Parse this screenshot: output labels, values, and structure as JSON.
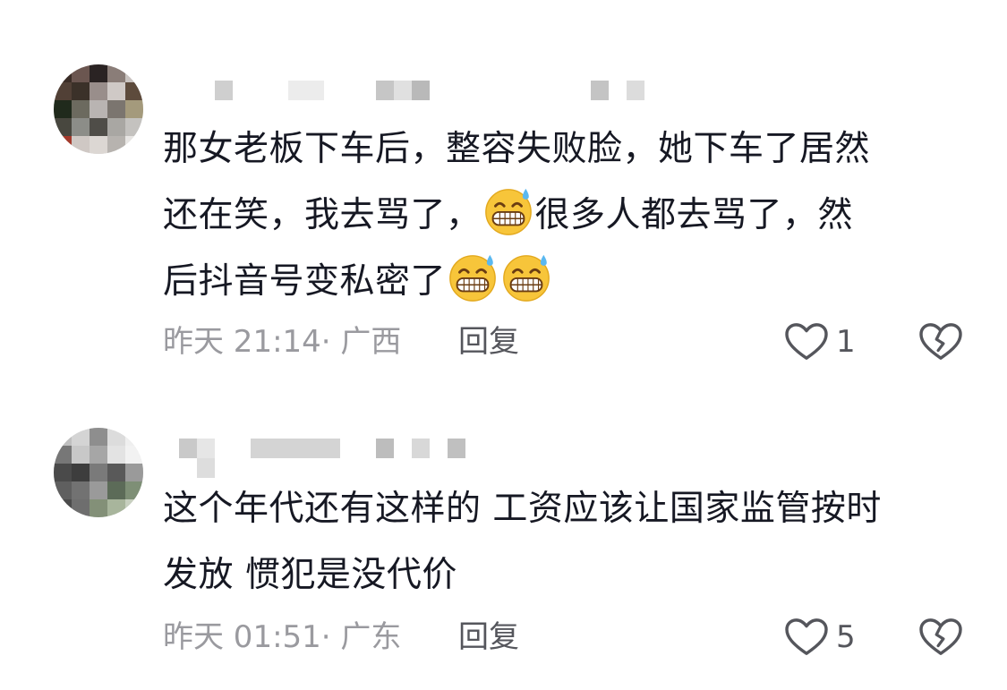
{
  "comments": [
    {
      "username": "",
      "content_lines": [
        "那女老板下车后，整容失败脸，她下车了居然",
        "还在笑，我去骂了，",
        "很多人都去骂了，然",
        "后抖音号变私密了"
      ],
      "emoji_name": "grimacing-sweat-emoji",
      "time": "昨天 21:14",
      "location": "· 广西",
      "reply_label": "回复",
      "like_count": "1"
    },
    {
      "username": "",
      "content_lines": [
        "这个年代还有这样的 工资应该让国家监管按时",
        "发放 惯犯是没代价"
      ],
      "time": "昨天 01:51",
      "location": "· 广东",
      "reply_label": "回复",
      "like_count": "5"
    }
  ],
  "icons": {
    "like": "heart-outline-icon",
    "dislike": "broken-heart-icon"
  },
  "colors": {
    "text": "#161823",
    "meta": "#9a9a9f",
    "icon": "#55565c",
    "emoji_face": "#f7c53a"
  }
}
